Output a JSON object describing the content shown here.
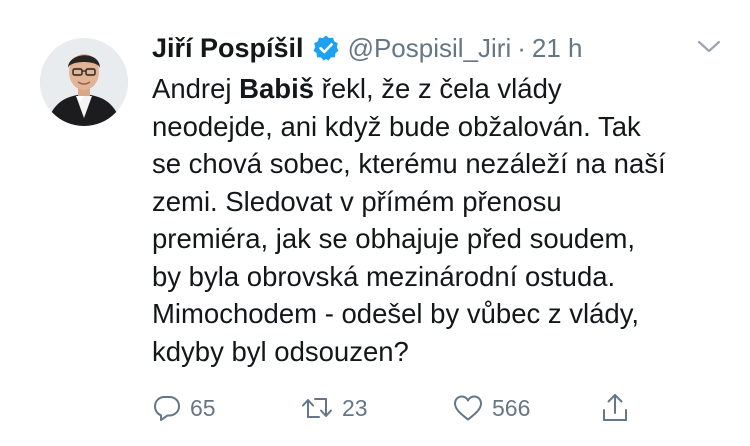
{
  "tweet": {
    "author_name": "Jiří Pospíšil",
    "handle": "@Pospisil_Jiri",
    "separator": "·",
    "time": "21 h",
    "verified": true,
    "lines": [
      {
        "a": "Andrej ",
        "b": "Babiš",
        "c": " řekl, že z čela vlády"
      },
      {
        "a": "neodejde, ani když bude obžalován. Tak"
      },
      {
        "a": "se chová sobec, kterému nezáleží na naší"
      },
      {
        "a": "zemi. Sledovat v přímém přenosu"
      },
      {
        "a": "premiéra, jak se obhajuje před soudem,"
      },
      {
        "a": "by byla obrovská mezinárodní ostuda."
      },
      {
        "a": "Mimochodem - odešel by vůbec z vlády,"
      },
      {
        "a": "kdyby byl odsouzen?"
      }
    ],
    "actions": {
      "replies": "65",
      "retweets": "23",
      "likes": "566"
    }
  },
  "icons": {
    "verified": "verified-badge-icon",
    "menu": "chevron-down-icon",
    "reply": "reply-icon",
    "retweet": "retweet-icon",
    "like": "heart-icon",
    "share": "share-icon"
  },
  "colors": {
    "text": "#14171a",
    "secondary": "#657786",
    "verified_blue": "#1da1f2",
    "background": "#ffffff"
  }
}
